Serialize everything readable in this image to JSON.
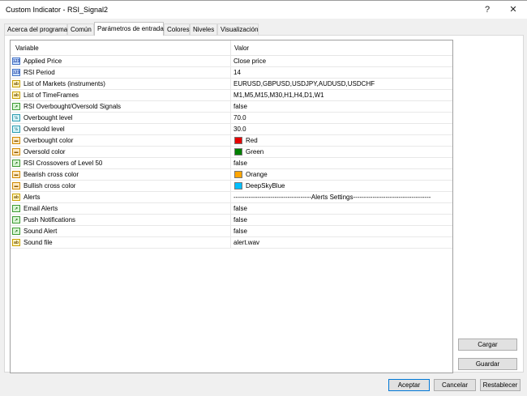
{
  "window": {
    "title": "Custom Indicator - RSI_Signal2",
    "help_label": "?",
    "close_label": "✕"
  },
  "tabs": [
    {
      "label": "Acerca del programa"
    },
    {
      "label": "Común"
    },
    {
      "label": "Parámetros de entrada"
    },
    {
      "label": "Colores"
    },
    {
      "label": "Niveles"
    },
    {
      "label": "Visualización"
    }
  ],
  "active_tab": "Parámetros de entrada",
  "table": {
    "col_variable": "Variable",
    "col_value": "Valor",
    "rows": [
      {
        "icon": "123",
        "icon_name": "integer-param-icon",
        "variable": "Applied Price",
        "value": "Close price"
      },
      {
        "icon": "123",
        "icon_name": "integer-param-icon",
        "variable": "RSI Period",
        "value": "14"
      },
      {
        "icon": "ab",
        "icon_name": "string-param-icon",
        "variable": "List of Markets (instruments)",
        "value": "EURUSD,GBPUSD,USDJPY,AUDUSD,USDCHF"
      },
      {
        "icon": "ab",
        "icon_name": "string-param-icon",
        "variable": "List of TimeFrames",
        "value": "M1,M5,M15,M30,H1,H4,D1,W1"
      },
      {
        "icon": "bool",
        "icon_name": "bool-param-icon",
        "variable": "RSI Overbought/Oversold Signals",
        "value": "false"
      },
      {
        "icon": "dbl",
        "icon_name": "double-param-icon",
        "variable": "Overbought level",
        "value": "70.0"
      },
      {
        "icon": "dbl",
        "icon_name": "double-param-icon",
        "variable": "Oversold level",
        "value": "30.0"
      },
      {
        "icon": "col",
        "icon_name": "color-param-icon",
        "variable": "Overbought color",
        "value": "Red",
        "swatch": "#e60000"
      },
      {
        "icon": "col",
        "icon_name": "color-param-icon",
        "variable": "Oversold color",
        "value": "Green",
        "swatch": "#008000"
      },
      {
        "icon": "bool",
        "icon_name": "bool-param-icon",
        "variable": "RSI Crossovers of Level 50",
        "value": "false"
      },
      {
        "icon": "col",
        "icon_name": "color-param-icon",
        "variable": "Bearish cross color",
        "value": "Orange",
        "swatch": "#ffa500"
      },
      {
        "icon": "col",
        "icon_name": "color-param-icon",
        "variable": "Bullish cross color",
        "value": "DeepSkyBlue",
        "swatch": "#00bfff"
      },
      {
        "icon": "ab",
        "icon_name": "string-param-icon",
        "variable": "Alerts",
        "value": "------------------------------------Alerts Settings------------------------------------"
      },
      {
        "icon": "bool",
        "icon_name": "bool-param-icon",
        "variable": "Email Alerts",
        "value": "false"
      },
      {
        "icon": "bool",
        "icon_name": "bool-param-icon",
        "variable": "Push Notifications",
        "value": "false"
      },
      {
        "icon": "bool",
        "icon_name": "bool-param-icon",
        "variable": "Sound Alert",
        "value": "false"
      },
      {
        "icon": "ab",
        "icon_name": "string-param-icon",
        "variable": "Sound file",
        "value": "alert.wav"
      }
    ]
  },
  "side_buttons": {
    "load_label": "Cargar",
    "save_label": "Guardar"
  },
  "footer_buttons": {
    "accept_label": "Aceptar",
    "cancel_label": "Cancelar",
    "reset_label": "Restablecer"
  }
}
